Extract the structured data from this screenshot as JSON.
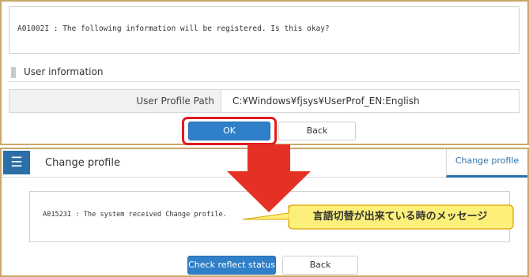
{
  "confirm_screen": {
    "message": "A01002I : The following information will be registered. Is this okay?",
    "section_title": "User information",
    "field_label": "User Profile Path",
    "field_value": "C:¥Windows¥fjsys¥UserProf_EN:English",
    "ok_label": "OK",
    "back_label": "Back"
  },
  "result_screen": {
    "title": "Change profile",
    "tab_label": "Change profile",
    "message": "A01523I : The system received Change profile.",
    "check_label": "Check reflect status",
    "back_label": "Back"
  },
  "annotation": {
    "callout_text": "言語切替が出来ている時のメッセージ",
    "arrow_color": "#e53124",
    "callout_fill": "#fdf07a",
    "callout_border": "#d9a400"
  },
  "colors": {
    "primary": "#2f80c8",
    "header_icon_bg": "#2c6fa8",
    "highlight": "#e01e1e",
    "panel_border": "#c9a86a"
  },
  "icons": {
    "menu": "hamburger-menu-icon",
    "section_marker": "section-marker-icon"
  }
}
